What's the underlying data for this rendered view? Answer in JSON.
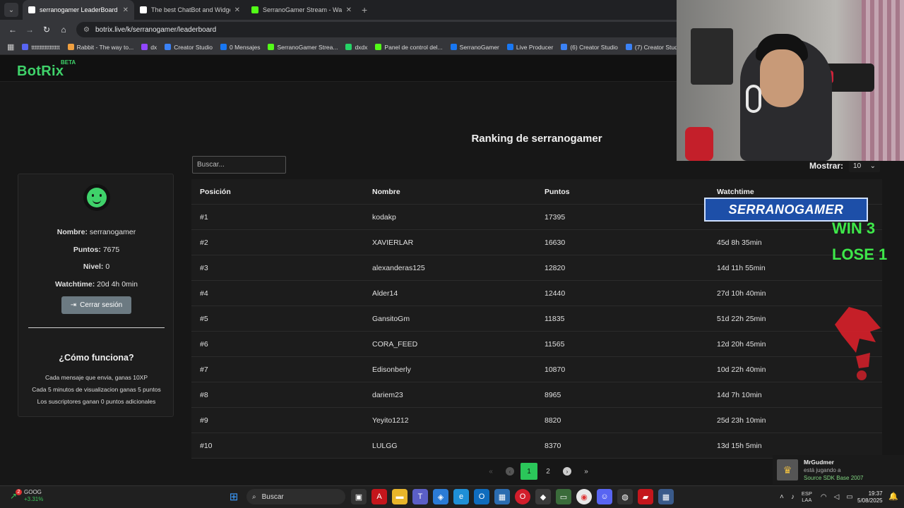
{
  "browser": {
    "tabs": [
      {
        "title": "serranogamer LeaderBoard | Th",
        "active": true,
        "color": "#ffffff"
      },
      {
        "title": "The best ChatBot and Widgets",
        "active": false,
        "color": "#ffffff"
      },
      {
        "title": "SerranoGamer Stream - Watch",
        "active": false,
        "color": "#53fc18"
      }
    ],
    "url": "botrix.live/k/serranogamer/leaderboard",
    "bookmarks": [
      {
        "label": "ttttttttttttttttt",
        "color": "#5865f2"
      },
      {
        "label": "Rabbit - The way to...",
        "color": "#f0a040"
      },
      {
        "label": "dx",
        "color": "#9146ff"
      },
      {
        "label": "Creator Studio",
        "color": "#3b82f6"
      },
      {
        "label": "0 Mensajes",
        "color": "#1877f2"
      },
      {
        "label": "SerranoGamer Strea...",
        "color": "#53fc18"
      },
      {
        "label": "dxdx",
        "color": "#25d366"
      },
      {
        "label": "Panel de control del...",
        "color": "#53fc18"
      },
      {
        "label": "SerranoGamer",
        "color": "#1877f2"
      },
      {
        "label": "Live Producer",
        "color": "#1877f2"
      },
      {
        "label": "(6) Creator Studio",
        "color": "#3b82f6"
      },
      {
        "label": "(7) Creator Studio",
        "color": "#3b82f6"
      }
    ]
  },
  "site": {
    "logo": "BotRix",
    "beta": "BETA",
    "accent": "#3fd26a"
  },
  "page": {
    "title": "Ranking de serranogamer",
    "search_placeholder": "Buscar...",
    "show_label": "Mostrar:",
    "show_value": "10"
  },
  "profile": {
    "name_label": "Nombre:",
    "name_value": "serranogamer",
    "points_label": "Puntos:",
    "points_value": "7675",
    "level_label": "Nivel:",
    "level_value": "0",
    "watch_label": "Watchtime:",
    "watch_value": "20d 4h 0min",
    "logout_label": "Cerrar sesión",
    "how_title": "¿Cómo funciona?",
    "how_lines": [
      "Cada mensaje que envia, ganas 10XP",
      "Cada 5 minutos de visualizacion ganas 5 puntos",
      "Los suscriptores ganan 0 puntos adicionales"
    ]
  },
  "table": {
    "headers": [
      "Posición",
      "Nombre",
      "Puntos",
      "Watchtime"
    ],
    "rows": [
      [
        "#1",
        "kodakp",
        "17395",
        ""
      ],
      [
        "#2",
        "XAVIERLAR",
        "16630",
        "45d 8h 35min"
      ],
      [
        "#3",
        "alexanderas125",
        "12820",
        "14d 11h 55min"
      ],
      [
        "#4",
        "Alder14",
        "12440",
        "27d 10h 40min"
      ],
      [
        "#5",
        "GansitoGm",
        "11835",
        "51d 22h 25min"
      ],
      [
        "#6",
        "CORA_FEED",
        "11565",
        "12d 20h 45min"
      ],
      [
        "#7",
        "Edisonberly",
        "10870",
        "10d 22h 40min"
      ],
      [
        "#8",
        "dariem23",
        "8965",
        "14d 7h 10min"
      ],
      [
        "#9",
        "Yeyito1212",
        "8820",
        "25d 23h 10min"
      ],
      [
        "#10",
        "LULGG",
        "8370",
        "13d 15h 5min"
      ]
    ]
  },
  "pagination": {
    "pages": [
      "1",
      "2"
    ],
    "current": "1"
  },
  "overlay": {
    "brand": "SERRANOGAMER",
    "win": "WIN 3",
    "lose": "LOSE 1",
    "win_color": "#3ee84a"
  },
  "notification": {
    "user": "MrGudmer",
    "status": "está jugando a",
    "game": "Source SDK Base 2007"
  },
  "taskbar": {
    "ticker_badge": "2",
    "ticker_name": "GOOG",
    "ticker_change": "+3.31%",
    "search_label": "Buscar",
    "lang_1": "ESP",
    "lang_2": "LAA",
    "time": "19:37",
    "date": "5/08/2025"
  }
}
